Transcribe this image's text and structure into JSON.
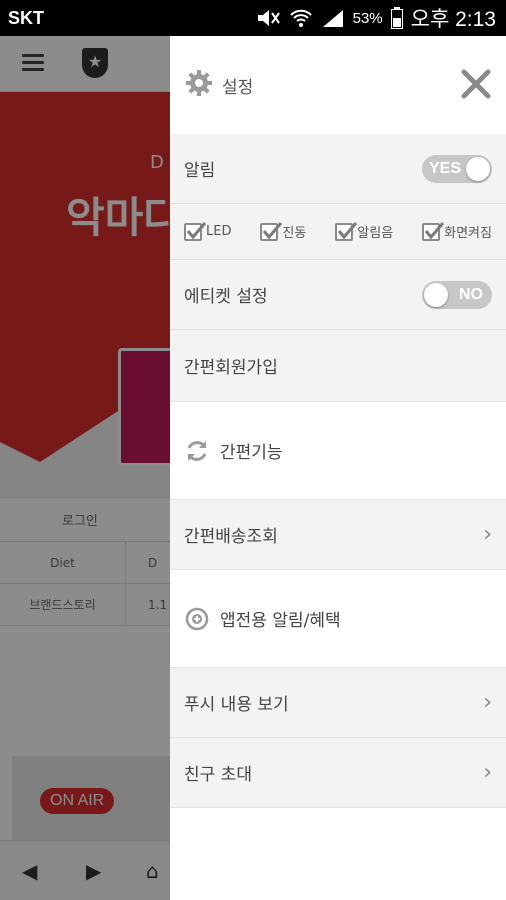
{
  "status_bar": {
    "carrier": "SKT",
    "battery": "53%",
    "time": "오후 2:13"
  },
  "background": {
    "headline": "악마다",
    "small_text": "D",
    "nav_login": "로그인",
    "table_rows": [
      {
        "c1": "Diet",
        "c2": "D"
      },
      {
        "c1": "브랜드스토리",
        "c2": "1.1"
      }
    ],
    "on_air": "ON AIR"
  },
  "drawer": {
    "title": "설정",
    "alarm": {
      "label": "알림",
      "toggle_text": "YES"
    },
    "checks": [
      {
        "label": "LED"
      },
      {
        "label": "진동"
      },
      {
        "label": "알림음"
      },
      {
        "label": "화면켜짐"
      }
    ],
    "etiquette": {
      "label": "에티켓 설정",
      "toggle_text": "NO"
    },
    "simple_join": "간편회원가입",
    "simple_func": "간편기능",
    "simple_delivery": "간편배송조회",
    "app_alarm": "앱전용 알림/혜택",
    "push_view": "푸시 내용 보기",
    "invite": "친구 초대"
  },
  "colors": {
    "accent_red": "#d92f2f",
    "toggle_gray": "#c7c7c7"
  }
}
